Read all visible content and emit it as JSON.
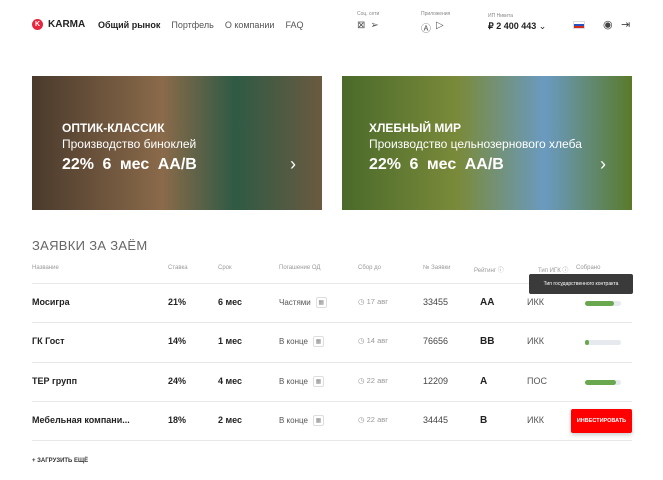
{
  "header": {
    "logo": "KARMA",
    "logo_letter": "K",
    "nav": [
      "Общий рынок",
      "Портфель",
      "О компании",
      "FAQ"
    ],
    "social_label": "Соц. сети",
    "apps_label": "Приложения",
    "account_label": "ИП Никита",
    "balance": "₽ 2 400 443"
  },
  "banners": [
    {
      "title": "ОПТИК-КЛАССИК",
      "subtitle": "Производство биноклей",
      "rate": "22%",
      "term": "6 мес",
      "rating": "AA/B"
    },
    {
      "title": "ХЛЕБНЫЙ МИР",
      "subtitle": "Производство цельнозернового хлеба",
      "rate": "22%",
      "term": "6 мес",
      "rating": "AA/B"
    }
  ],
  "section_title": "ЗАЯВКИ ЗА ЗАЁМ",
  "columns": [
    "Название",
    "Ставка",
    "Срок",
    "Погашение ОД",
    "Сбор до",
    "№ Заявки",
    "Рейтинг",
    "Тип ИГК",
    "Собрано"
  ],
  "tooltip": "Тип государственного контракта",
  "rows": [
    {
      "name": "Мосигра",
      "rate": "21%",
      "term": "6 мес",
      "repay": "Частями",
      "date": "17 авг",
      "num": "33455",
      "rating": "AA",
      "type": "ИКК",
      "collected": 0.8
    },
    {
      "name": "ГК Гост",
      "rate": "14%",
      "term": "1 мес",
      "repay": "В конце",
      "date": "14 авг",
      "num": "76656",
      "rating": "BB",
      "type": "ИКК",
      "collected": 0.12
    },
    {
      "name": "ТЕР групп",
      "rate": "24%",
      "term": "4 мес",
      "repay": "В конце",
      "date": "22 авг",
      "num": "12209",
      "rating": "A",
      "type": "ПОС",
      "collected": 0.85
    },
    {
      "name": "Мебельная компани...",
      "rate": "18%",
      "term": "2 мес",
      "repay": "В конце",
      "date": "22 авг",
      "num": "34445",
      "rating": "B",
      "type": "ИКК",
      "invest_label": "ИНВЕСТИРОВАТЬ"
    }
  ],
  "load_more": "+ ЗАГРУЗИТЬ ЕЩЁ",
  "colors": {
    "brand": "#e8253c",
    "progress": "#6aa84f",
    "invest": "#ff0000"
  }
}
